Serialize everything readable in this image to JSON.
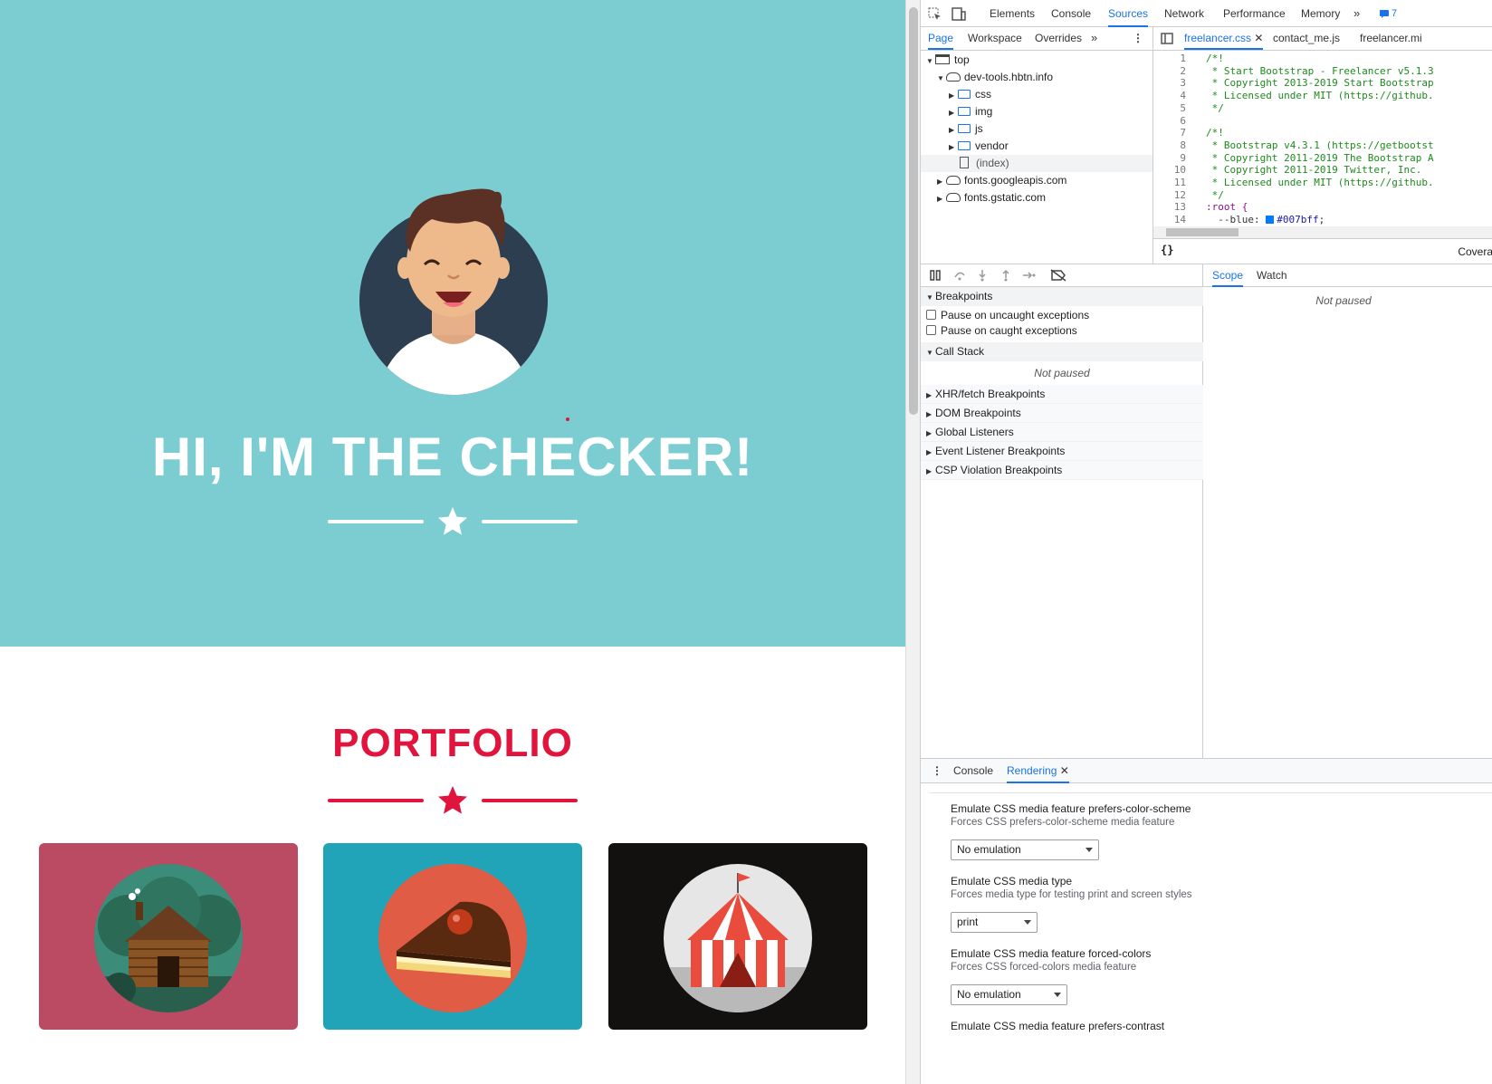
{
  "page": {
    "hero_title": "HI, I'M THE CHECKER!",
    "portfolio_title": "PORTFOLIO",
    "colors": {
      "hero_bg": "#7ccdd1",
      "accent": "#e0143c",
      "card1": "#ba4b62",
      "card2": "#21a4b8",
      "card3": "#131010"
    },
    "cards": [
      {
        "name": "cabin",
        "icon": "log-cabin-icon"
      },
      {
        "name": "cake",
        "icon": "cake-slice-icon"
      },
      {
        "name": "circus",
        "icon": "circus-tent-icon"
      }
    ]
  },
  "devtools": {
    "top_tabs": [
      "Elements",
      "Console",
      "Sources",
      "Network",
      "Performance",
      "Memory"
    ],
    "active_tab": "Sources",
    "issues_count": "7",
    "nav_tabs": [
      "Page",
      "Workspace",
      "Overrides"
    ],
    "file_tabs": [
      "freelancer.css",
      "contact_me.js",
      "freelancer.mi"
    ],
    "tree": {
      "top": "top",
      "domain": "dev-tools.hbtn.info",
      "folders": [
        "css",
        "img",
        "js",
        "vendor"
      ],
      "index": "(index)",
      "others": [
        "fonts.googleapis.com",
        "fonts.gstatic.com"
      ]
    },
    "code_lines": [
      {
        "n": "1",
        "t": "/*!"
      },
      {
        "n": "2",
        "t": " * Start Bootstrap - Freelancer v5.1.3"
      },
      {
        "n": "3",
        "t": " * Copyright 2013-2019 Start Bootstrap"
      },
      {
        "n": "4",
        "t": " * Licensed under MIT (https://github."
      },
      {
        "n": "5",
        "t": " */"
      },
      {
        "n": "6",
        "t": ""
      },
      {
        "n": "7",
        "t": "/*!"
      },
      {
        "n": "8",
        "t": " * Bootstrap v4.3.1 (https://getbootst"
      },
      {
        "n": "9",
        "t": " * Copyright 2011-2019 The Bootstrap A"
      },
      {
        "n": "10",
        "t": " * Copyright 2011-2019 Twitter, Inc."
      },
      {
        "n": "11",
        "t": " * Licensed under MIT (https://github."
      },
      {
        "n": "12",
        "t": " */"
      },
      {
        "n": "13",
        "t": ":root {"
      },
      {
        "n": "14",
        "t": "  --blue: "
      }
    ],
    "code_color_value": "#007bff",
    "coverage_label": "Covera",
    "breakpoints": {
      "header": "Breakpoints",
      "pause_uncaught": "Pause on uncaught exceptions",
      "pause_caught": "Pause on caught exceptions",
      "call_stack": "Call Stack",
      "not_paused": "Not paused",
      "panes": [
        "XHR/fetch Breakpoints",
        "DOM Breakpoints",
        "Global Listeners",
        "Event Listener Breakpoints",
        "CSP Violation Breakpoints"
      ]
    },
    "scope_tabs": [
      "Scope",
      "Watch"
    ],
    "scope_not_paused": "Not paused",
    "drawer": {
      "tabs": [
        "Console",
        "Rendering"
      ],
      "items": [
        {
          "label": "Emulate CSS media feature prefers-color-scheme",
          "sub": "Forces CSS prefers-color-scheme media feature",
          "value": "No emulation"
        },
        {
          "label": "Emulate CSS media type",
          "sub": "Forces media type for testing print and screen styles",
          "value": "print"
        },
        {
          "label": "Emulate CSS media feature forced-colors",
          "sub": "Forces CSS forced-colors media feature",
          "value": "No emulation"
        },
        {
          "label": "Emulate CSS media feature prefers-contrast"
        }
      ]
    }
  }
}
